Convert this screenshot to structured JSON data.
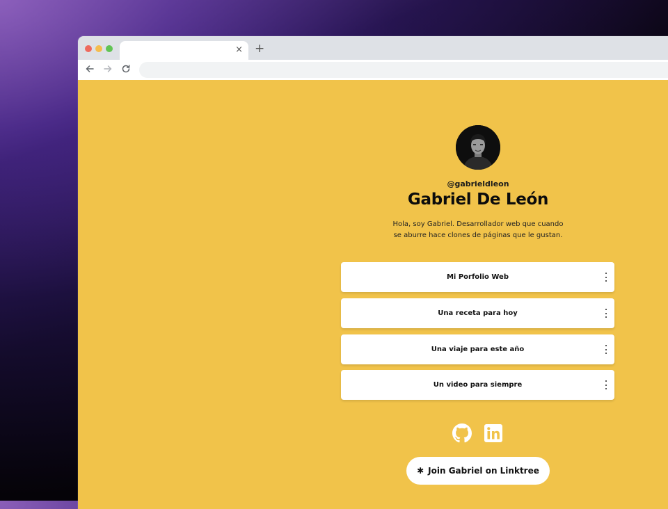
{
  "browser": {
    "tab_title": "",
    "tab_close": "×",
    "new_tab": "+",
    "address": ""
  },
  "profile": {
    "handle": "@gabrieldleon",
    "name": "Gabriel De León",
    "bio_line1": "Hola, soy Gabriel. Desarrollador web que cuando",
    "bio_line2": "se aburre hace clones de páginas que le gustan."
  },
  "links": [
    {
      "label": "Mi Porfolio Web"
    },
    {
      "label": "Una receta para hoy"
    },
    {
      "label": "Una viaje para este año"
    },
    {
      "label": "Un video para siempre"
    }
  ],
  "socials": [
    "github-icon",
    "linkedin-icon"
  ],
  "cta": {
    "label": "Join Gabriel on Linktree",
    "icon": "✱"
  },
  "colors": {
    "page_background": "#f1c34a",
    "card_background": "#ffffff",
    "text": "#111111"
  }
}
